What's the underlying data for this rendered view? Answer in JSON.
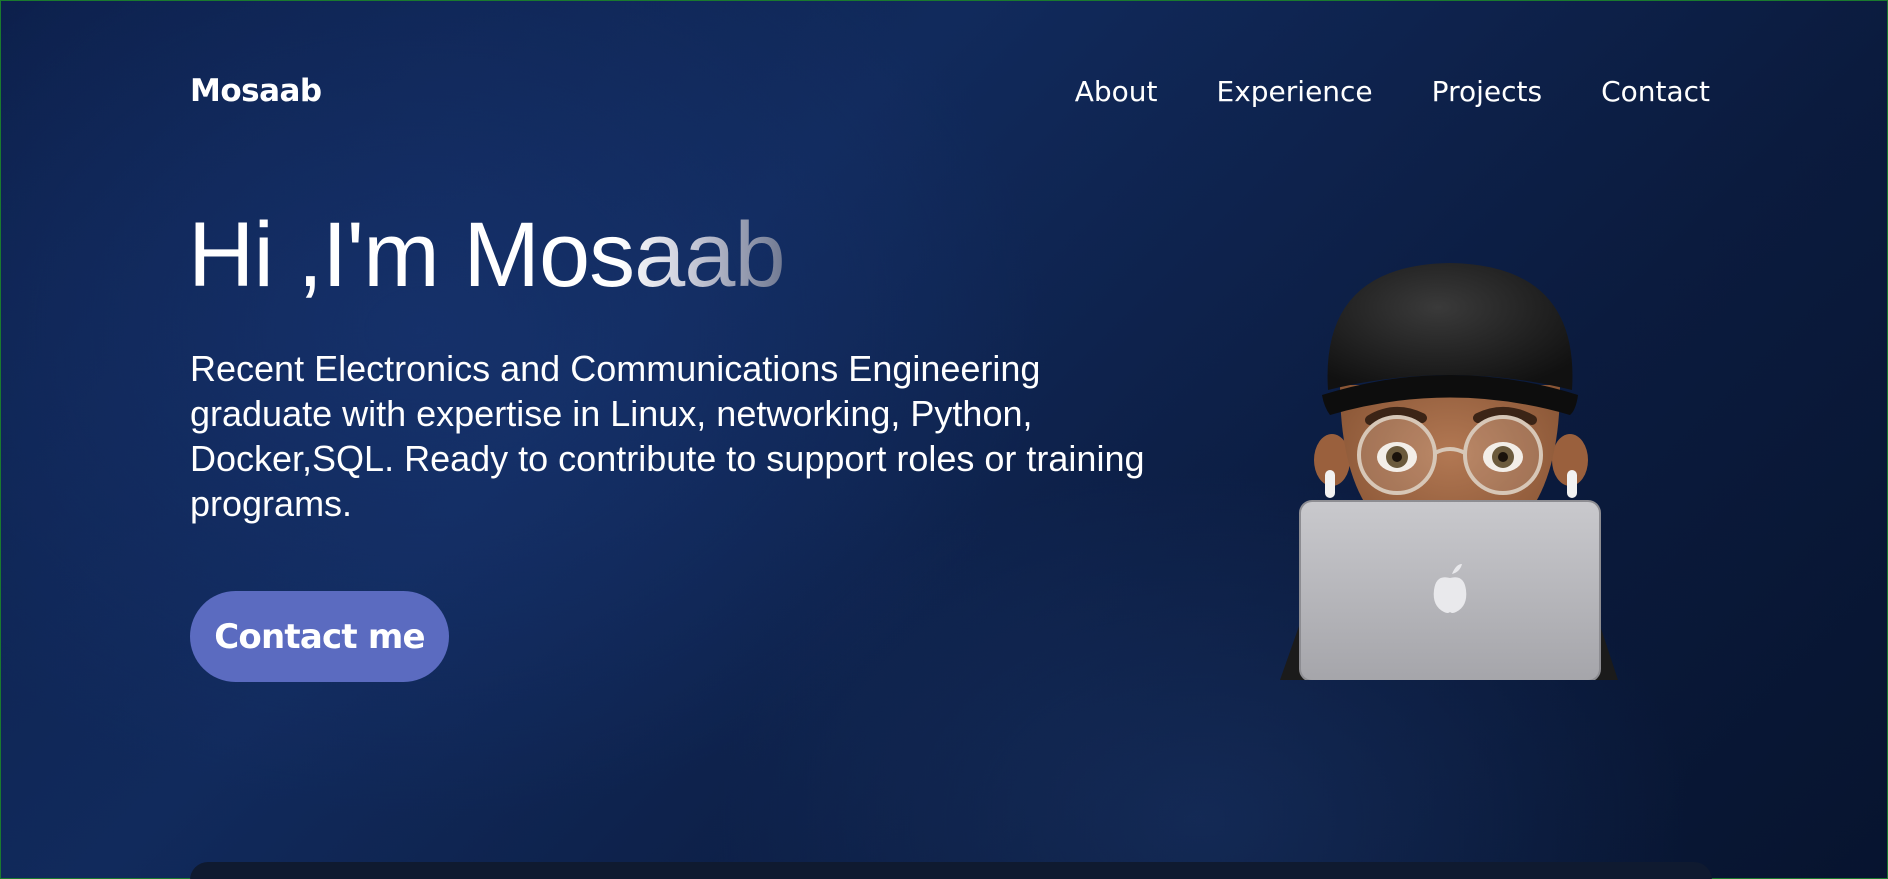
{
  "header": {
    "logo": "Mosaab",
    "nav": [
      {
        "label": "About"
      },
      {
        "label": "Experience"
      },
      {
        "label": "Projects"
      },
      {
        "label": "Contact"
      }
    ]
  },
  "hero": {
    "title": "Hi ,I'm Mosaab",
    "description": "Recent Electronics and Communications Engineering graduate with expertise in Linux, networking, Python, Docker,SQL. Ready to contribute to support roles or training programs.",
    "cta_label": "Contact me",
    "avatar_icon": "memoji-avatar-with-laptop"
  },
  "colors": {
    "background_dark": "#0b1b3e",
    "background_accent": "#112a5c",
    "button": "#5b6bc0",
    "text": "#ffffff",
    "card": "#0f1a30"
  }
}
